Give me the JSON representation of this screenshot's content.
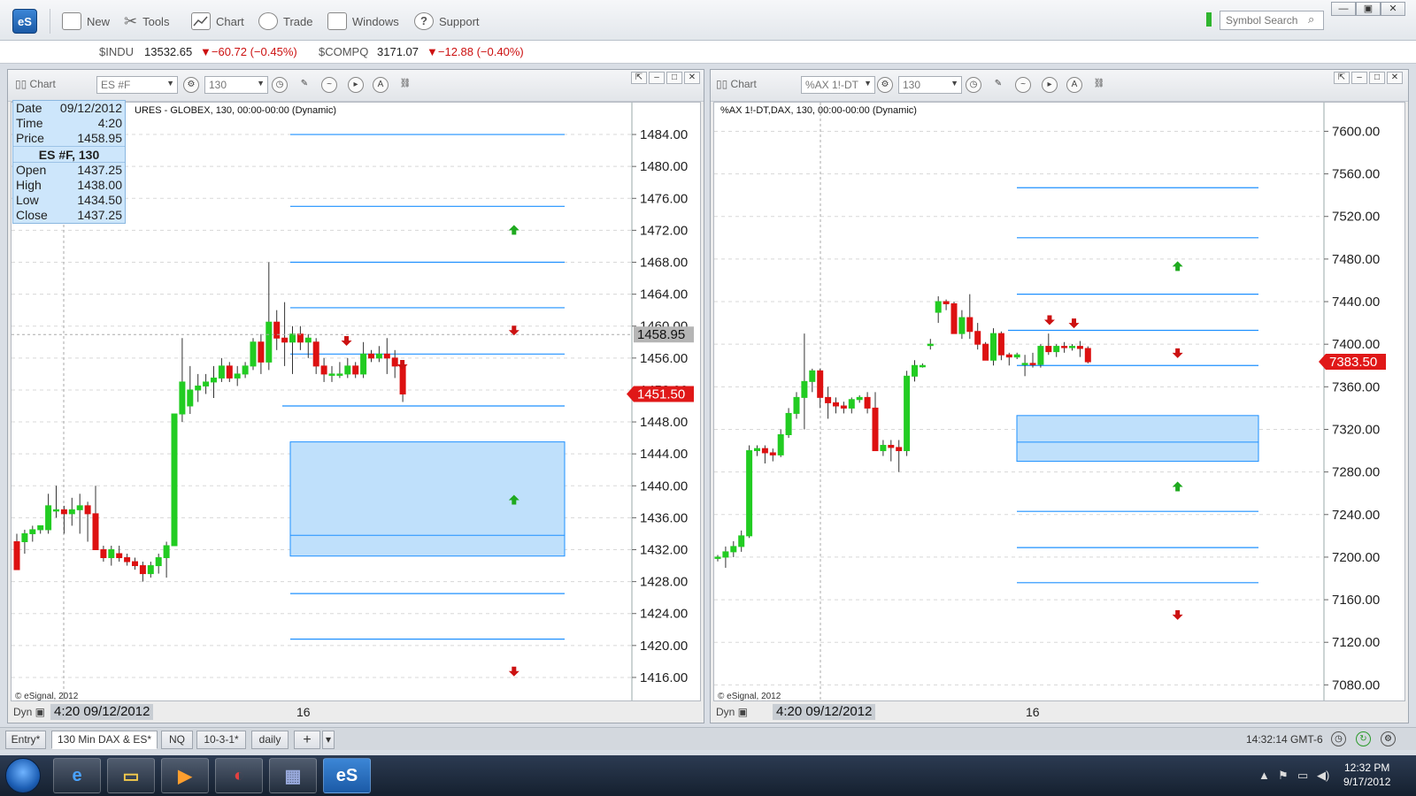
{
  "app": {
    "logo": "eS",
    "search_placeholder": "Symbol Search"
  },
  "toolbar": {
    "items": [
      {
        "label": "New",
        "icon": "new-window-icon"
      },
      {
        "label": "Tools",
        "icon": "tools-icon"
      },
      {
        "label": "Chart",
        "icon": "chart-icon"
      },
      {
        "label": "Trade",
        "icon": "trade-icon"
      },
      {
        "label": "Windows",
        "icon": "windows-icon"
      },
      {
        "label": "Support",
        "icon": "help-icon"
      }
    ],
    "window_controls": [
      "—",
      "▣",
      "✕"
    ]
  },
  "ticker": [
    {
      "symbol": "$INDU",
      "price": "13532.65",
      "change": "▼−60.72 (−0.45%)"
    },
    {
      "symbol": "$COMPQ",
      "price": "3171.07",
      "change": "▼−12.88 (−0.40%)"
    }
  ],
  "colors": {
    "up_candle": "#22cc22",
    "down_candle": "#dd1111",
    "level_line": "#1e90ff",
    "zone_fill": "#bfe0fb",
    "price_tag_red": "#e01818",
    "price_tag_gray": "#b5b5b5",
    "arrow_up": "#1faa1f",
    "arrow_down": "#cc1111"
  },
  "left_chart": {
    "header_label": "Chart",
    "symbol": "ES #F",
    "interval": "130",
    "title": "URES - GLOBEX, 130, 00:00-00:00 (Dynamic)",
    "copyright": "© eSignal, 2012",
    "dyn": "Dyn",
    "cursor_time": "4:20 09/12/2012",
    "x_tick": "16",
    "data_window": {
      "date_label": "Date",
      "date": "09/12/2012",
      "time_label": "Time",
      "time": "4:20",
      "price_label": "Price",
      "price": "1458.95",
      "header": "ES #F, 130",
      "open_label": "Open",
      "open": "1437.25",
      "high_label": "High",
      "high": "1438.00",
      "low_label": "Low",
      "low": "1434.50",
      "close_label": "Close",
      "close": "1437.25"
    },
    "price_tags": {
      "cursor": "1458.95",
      "last": "1451.50"
    },
    "y_ticks": [
      "1484.00",
      "1480.00",
      "1476.00",
      "1472.00",
      "1468.00",
      "1464.00",
      "1460.00",
      "1456.00",
      "1452.00",
      "1448.00",
      "1444.00",
      "1440.00",
      "1436.00",
      "1432.00",
      "1428.00",
      "1424.00",
      "1420.00",
      "1416.00"
    ]
  },
  "right_chart": {
    "header_label": "Chart",
    "symbol": "%AX 1!-DT",
    "interval": "130",
    "title": "%AX 1!-DT,DAX, 130, 00:00-00:00 (Dynamic)",
    "copyright": "© eSignal, 2012",
    "dyn": "Dyn",
    "cursor_time": "4:20 09/12/2012",
    "x_tick": "16",
    "price_tags": {
      "last": "7383.50"
    },
    "y_ticks": [
      "7600.00",
      "7560.00",
      "7520.00",
      "7480.00",
      "7440.00",
      "7400.00",
      "7360.00",
      "7320.00",
      "7280.00",
      "7240.00",
      "7200.00",
      "7160.00",
      "7120.00",
      "7080.00"
    ]
  },
  "chart_data": [
    {
      "type": "candlestick",
      "title": "URES - GLOBEX, 130, 00:00-00:00 (Dynamic)",
      "ylim": [
        1414,
        1486
      ],
      "levels": [
        1484,
        1475,
        1468,
        1462.3,
        1456.5,
        1450,
        1426.5,
        1420.8
      ],
      "zone": {
        "from": 1431.2,
        "to": 1445.5,
        "mid": 1433.8
      },
      "arrows": [
        {
          "dir": "up",
          "x": 0.81,
          "y": 1472
        },
        {
          "dir": "down",
          "x": 0.81,
          "y": 1459.5
        },
        {
          "dir": "up",
          "x": 0.81,
          "y": 1438.2
        },
        {
          "dir": "down",
          "x": 0.81,
          "y": 1416.8
        },
        {
          "dir": "down",
          "x": 0.54,
          "y": 1458.2
        },
        {
          "dir": "down",
          "x": 0.63,
          "y": 1455.2
        }
      ],
      "candles": [
        [
          1433,
          1434,
          1429.5,
          1429.5
        ],
        [
          1433,
          1434.5,
          1431.5,
          1434
        ],
        [
          1434,
          1435,
          1433,
          1434.5
        ],
        [
          1434.5,
          1435,
          1434,
          1435
        ],
        [
          1434.5,
          1439,
          1434,
          1437.5
        ],
        [
          1437,
          1440,
          1436,
          1437
        ],
        [
          1437,
          1437.5,
          1434,
          1436.5
        ],
        [
          1436.5,
          1438.5,
          1435,
          1437
        ],
        [
          1437,
          1439,
          1434,
          1437.5
        ],
        [
          1437.5,
          1438,
          1433,
          1436.5
        ],
        [
          1436.5,
          1440,
          1432,
          1432
        ],
        [
          1432,
          1432.5,
          1430.5,
          1431
        ],
        [
          1431,
          1432.5,
          1430,
          1432
        ],
        [
          1431.5,
          1432.5,
          1430.5,
          1431
        ],
        [
          1431,
          1431.5,
          1430,
          1430.5
        ],
        [
          1430.5,
          1431,
          1429.5,
          1430
        ],
        [
          1430,
          1430.5,
          1428,
          1429
        ],
        [
          1429,
          1430.5,
          1428.5,
          1430
        ],
        [
          1430,
          1431.5,
          1429,
          1431
        ],
        [
          1431,
          1433,
          1428.5,
          1432.5
        ],
        [
          1432.5,
          1449,
          1432.5,
          1449
        ],
        [
          1449,
          1458.5,
          1448,
          1453
        ],
        [
          1450,
          1455,
          1449,
          1452
        ],
        [
          1452,
          1454,
          1450.5,
          1452.5
        ],
        [
          1452.5,
          1454,
          1451.5,
          1453
        ],
        [
          1453,
          1455,
          1451,
          1453.5
        ],
        [
          1453.5,
          1456,
          1453,
          1455
        ],
        [
          1455,
          1455.5,
          1453,
          1453.5
        ],
        [
          1453.5,
          1455,
          1452.5,
          1454
        ],
        [
          1454,
          1455.5,
          1453.5,
          1455
        ],
        [
          1455,
          1458.5,
          1454.5,
          1458
        ],
        [
          1458,
          1459,
          1454,
          1455.5
        ],
        [
          1455.5,
          1468,
          1454.5,
          1460.5
        ],
        [
          1460.5,
          1462,
          1457,
          1458.5
        ],
        [
          1458.5,
          1463,
          1455,
          1458
        ],
        [
          1458,
          1460,
          1454,
          1459
        ],
        [
          1459,
          1460,
          1457,
          1458
        ],
        [
          1458,
          1459,
          1456,
          1458.5
        ],
        [
          1458,
          1458.5,
          1454,
          1455
        ],
        [
          1455,
          1456,
          1453,
          1454
        ],
        [
          1454,
          1455,
          1453,
          1454
        ],
        [
          1454,
          1455.5,
          1453.5,
          1454
        ],
        [
          1454,
          1456,
          1453.5,
          1455
        ],
        [
          1455,
          1455.5,
          1453.5,
          1454
        ],
        [
          1454,
          1458,
          1453.5,
          1456.5
        ],
        [
          1456.5,
          1457,
          1455.5,
          1456
        ],
        [
          1456,
          1457.5,
          1455.5,
          1456.5
        ],
        [
          1456.5,
          1458.5,
          1454,
          1456
        ],
        [
          1456,
          1457,
          1453.5,
          1455
        ],
        [
          1455,
          1455.5,
          1450.5,
          1451.5
        ]
      ],
      "x_tick": "16"
    },
    {
      "type": "candlestick",
      "title": "%AX 1!-DT,DAX, 130, 00:00-00:00 (Dynamic)",
      "ylim": [
        7072,
        7612
      ],
      "levels": [
        7547,
        7500,
        7447,
        7413,
        7380,
        7243,
        7209,
        7176
      ],
      "zone": {
        "from": 7290,
        "to": 7333,
        "mid": 7308
      },
      "arrows": [
        {
          "dir": "up",
          "x": 0.76,
          "y": 7473
        },
        {
          "dir": "down",
          "x": 0.76,
          "y": 7392
        },
        {
          "dir": "up",
          "x": 0.76,
          "y": 7266
        },
        {
          "dir": "down",
          "x": 0.76,
          "y": 7146
        },
        {
          "dir": "down",
          "x": 0.55,
          "y": 7423
        },
        {
          "dir": "down",
          "x": 0.59,
          "y": 7420
        }
      ],
      "candles": [
        [
          7200,
          7202,
          7196,
          7200
        ],
        [
          7200,
          7210,
          7190,
          7205
        ],
        [
          7205,
          7215,
          7200,
          7210
        ],
        [
          7210,
          7225,
          7205,
          7220
        ],
        [
          7220,
          7305,
          7218,
          7300
        ],
        [
          7300,
          7305,
          7295,
          7302
        ],
        [
          7302,
          7305,
          7288,
          7298
        ],
        [
          7298,
          7302,
          7290,
          7296
        ],
        [
          7296,
          7320,
          7294,
          7315
        ],
        [
          7315,
          7340,
          7312,
          7335
        ],
        [
          7335,
          7355,
          7330,
          7350
        ],
        [
          7350,
          7410,
          7320,
          7365
        ],
        [
          7365,
          7377,
          7355,
          7375
        ],
        [
          7375,
          7377,
          7340,
          7350
        ],
        [
          7350,
          7360,
          7330,
          7345
        ],
        [
          7345,
          7350,
          7335,
          7342
        ],
        [
          7342,
          7346,
          7335,
          7340
        ],
        [
          7340,
          7350,
          7335,
          7348
        ],
        [
          7348,
          7352,
          7345,
          7350
        ],
        [
          7350,
          7355,
          7335,
          7340
        ],
        [
          7340,
          7355,
          7305,
          7300
        ],
        [
          7300,
          7310,
          7295,
          7305
        ],
        [
          7305,
          7310,
          7290,
          7303
        ],
        [
          7303,
          7310,
          7280,
          7300
        ],
        [
          7300,
          7375,
          7295,
          7370
        ],
        [
          7370,
          7385,
          7365,
          7380
        ],
        [
          7380,
          7382,
          7378,
          7380
        ],
        [
          7400,
          7405,
          7395,
          7400
        ],
        [
          7430,
          7445,
          7420,
          7440
        ],
        [
          7440,
          7442,
          7432,
          7438
        ],
        [
          7438,
          7440,
          7410,
          7410
        ],
        [
          7410,
          7432,
          7405,
          7425
        ],
        [
          7425,
          7447,
          7405,
          7412
        ],
        [
          7412,
          7420,
          7395,
          7400
        ],
        [
          7400,
          7402,
          7385,
          7385
        ],
        [
          7385,
          7415,
          7380,
          7410
        ],
        [
          7410,
          7412,
          7385,
          7390
        ],
        [
          7390,
          7392,
          7380,
          7388
        ],
        [
          7388,
          7392,
          7386,
          7390
        ],
        [
          7382,
          7390,
          7370,
          7382
        ],
        [
          7382,
          7392,
          7378,
          7381
        ],
        [
          7381,
          7400,
          7378,
          7398
        ],
        [
          7398,
          7410,
          7390,
          7393
        ],
        [
          7393,
          7400,
          7388,
          7398
        ],
        [
          7398,
          7402,
          7392,
          7397
        ],
        [
          7397,
          7400,
          7394,
          7398
        ],
        [
          7398,
          7403,
          7388,
          7396
        ],
        [
          7396,
          7398,
          7382,
          7383.5
        ]
      ],
      "x_tick": "16"
    }
  ],
  "tabs": [
    "Entry*",
    "130 Min DAX & ES*",
    "NQ",
    "10-3-1*",
    "daily",
    "+",
    "▾"
  ],
  "status": {
    "clock": "14:32:14 GMT-6"
  },
  "taskbar": {
    "apps": [
      "ie-icon",
      "explorer-icon",
      "media-icon",
      "app-icon",
      "network-icon",
      "esignal-icon"
    ],
    "esignal_label": "eS",
    "time": "12:32 PM",
    "date": "9/17/2012"
  }
}
